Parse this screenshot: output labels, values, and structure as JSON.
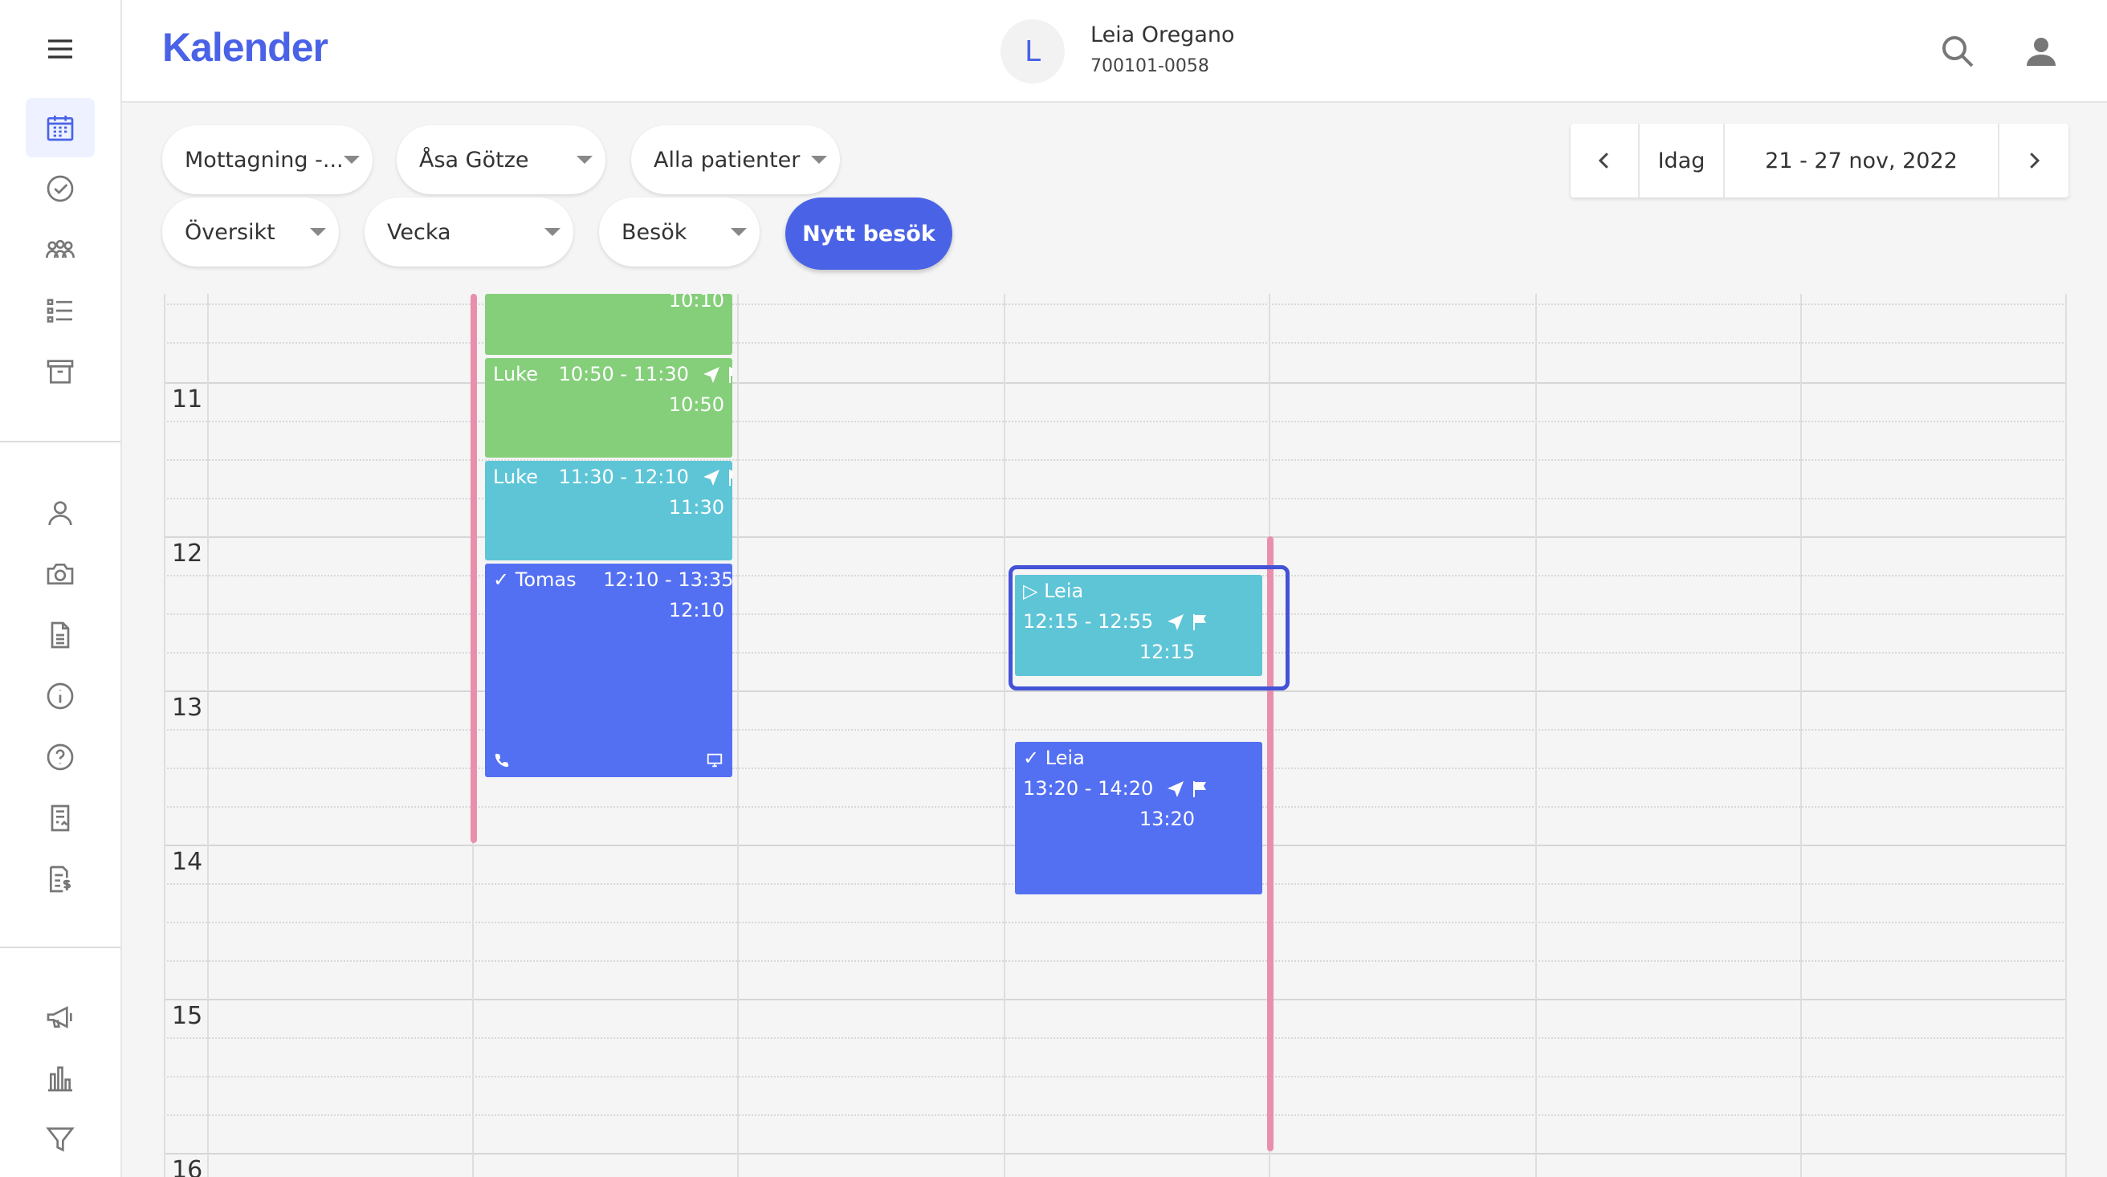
{
  "app": {
    "title": "Kalender"
  },
  "patient": {
    "initial": "L",
    "name": "Leia Oregano",
    "id": "700101-0058"
  },
  "header_icons": {
    "search": "search-icon",
    "account": "account-icon"
  },
  "sidebar": {
    "menu": "menu-icon",
    "groups": [
      [
        "calendar-icon",
        "check-circle-icon",
        "group-icon",
        "list-icon",
        "archive-icon"
      ],
      [
        "person-icon",
        "camera-icon",
        "document-icon",
        "info-icon",
        "help-icon",
        "form-icon",
        "invoice-icon"
      ],
      [
        "megaphone-icon",
        "bar-chart-icon",
        "filter-icon"
      ]
    ]
  },
  "filters": {
    "reception": "Mottagning -...",
    "practitioner": "Åsa Götze",
    "patients": "Alla patienter",
    "view": "Översikt",
    "period": "Vecka",
    "type": "Besök",
    "new_visit": "Nytt besök"
  },
  "datenav": {
    "today": "Idag",
    "range": "21 - 27 nov, 2022"
  },
  "calendar": {
    "hours": [
      "11",
      "12",
      "13",
      "14",
      "15",
      "16"
    ],
    "events": [
      {
        "id": "e0",
        "color": "green",
        "lines": [
          "10:10"
        ]
      },
      {
        "id": "e1",
        "color": "green",
        "name": "Luke",
        "time": "10:50 - 11:30",
        "start": "10:50"
      },
      {
        "id": "e2",
        "color": "teal",
        "name": "Luke",
        "time": "11:30 - 12:10",
        "start": "11:30"
      },
      {
        "id": "e3",
        "color": "blue",
        "name": "✓ Tomas",
        "time": "12:10 - 13:35",
        "start": "12:10"
      },
      {
        "id": "e4",
        "color": "teal",
        "name": "▷ Leia",
        "time": "12:15 - 12:55",
        "start": "12:15"
      },
      {
        "id": "e5",
        "color": "blue",
        "name": "✓ Leia",
        "time": "13:20 - 14:20",
        "start": "13:20"
      }
    ]
  },
  "colors": {
    "accent": "#4a63e6",
    "green": "#85cf7b",
    "teal": "#5ec5d7",
    "blue": "#5470f2",
    "now_line": "#e98fac"
  }
}
